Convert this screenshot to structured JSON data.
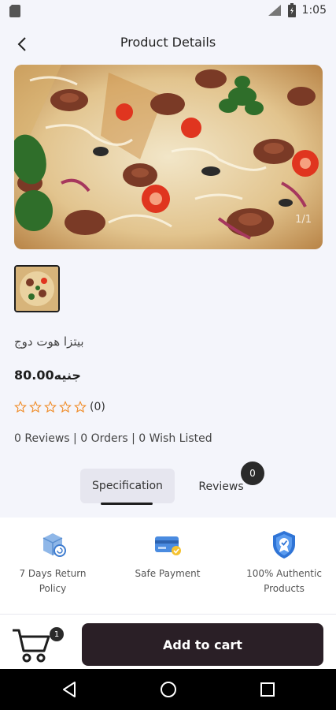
{
  "status_bar": {
    "time": "1:05"
  },
  "header": {
    "title": "Product Details"
  },
  "gallery": {
    "counter": "1/1"
  },
  "product": {
    "name": "بيتزا هوت دوج",
    "price": "80.00جنيه",
    "rating_count": "(0)",
    "stats": "0 Reviews | 0 Orders | 0 Wish Listed"
  },
  "tabs": {
    "specification": "Specification",
    "reviews": "Reviews",
    "reviews_badge": "0"
  },
  "features": [
    {
      "label_line1": "7 Days Return",
      "label_line2": "Policy",
      "icon": "return-box-icon"
    },
    {
      "label_line1": "Safe Payment",
      "label_line2": "",
      "icon": "credit-card-icon"
    },
    {
      "label_line1": "100% Authentic",
      "label_line2": "Products",
      "icon": "shield-badge-icon"
    }
  ],
  "cart": {
    "badge": "1",
    "add_label": "Add to cart"
  },
  "colors": {
    "accent": "#2a1f26",
    "star": "#f08a24",
    "background": "#f4f5fb"
  }
}
